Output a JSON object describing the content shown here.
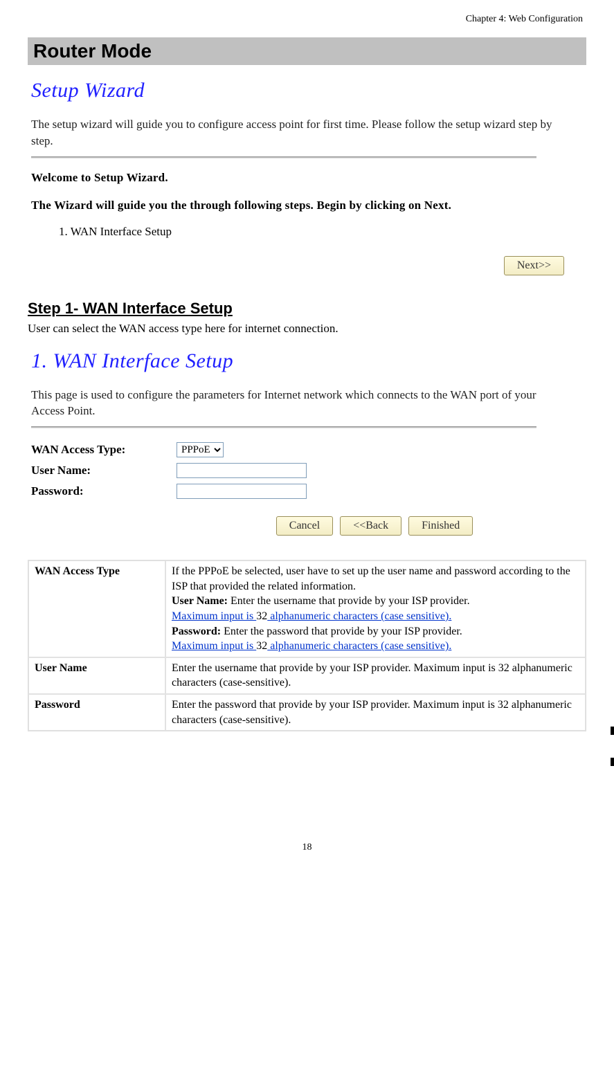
{
  "chapter": "Chapter 4: Web Configuration",
  "sectionTitle": "Router Mode",
  "wizard": {
    "heading": "Setup Wizard",
    "intro": "The setup wizard will guide you to configure access point for first time. Please follow the setup wizard step by step.",
    "welcome": "Welcome to Setup Wizard.",
    "guide": "The Wizard will guide you the through following steps. Begin by clicking on Next.",
    "listItem": "1.    WAN Interface Setup",
    "nextBtn": "Next>>"
  },
  "step1": {
    "heading": "Step 1- WAN Interface Setup",
    "intro": "User can select the WAN access type here for internet connection."
  },
  "wanSetup": {
    "heading": "1. WAN Interface Setup",
    "intro": "This page is used to configure the parameters for Internet network which connects to the WAN port of your Access Point.",
    "labels": {
      "accessType": "WAN Access Type:",
      "userName": "User Name:",
      "password": "Password:"
    },
    "accessTypeValue": "PPPoE",
    "buttons": {
      "cancel": "Cancel",
      "back": "<<Back",
      "finished": "Finished"
    }
  },
  "descTable": {
    "row1": {
      "key": "WAN Access Type",
      "line1": "If the PPPoE be selected, user have to set up the user name and password according to the ISP that provided the related information.",
      "ul": "User Name:",
      "ut": " Enter the username that provide by your ISP provider. ",
      "ub1": "Maximum input is ",
      "ub2": "32",
      "ub3": " alphanumeric characters (case sensitive).",
      "pl": "Password:",
      "pt": " Enter the password that provide by your ISP provider. ",
      "pb1": "Maximum input is ",
      "pb2": "32",
      "pb3": " alphanumeric characters (case sensitive)."
    },
    "row2": {
      "key": "User Name",
      "val": "Enter the username that provide by your ISP provider. Maximum input is 32 alphanumeric characters (case-sensitive)."
    },
    "row3": {
      "key": "Password",
      "val": "Enter the password that provide by your ISP provider. Maximum input is 32 alphanumeric characters (case-sensitive)."
    }
  },
  "pageNumber": "18"
}
